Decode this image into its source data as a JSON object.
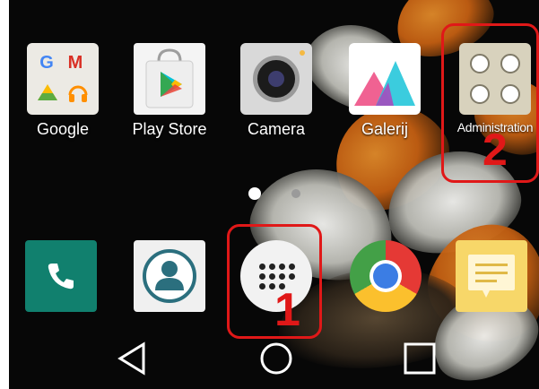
{
  "home_row": [
    {
      "label": "Google",
      "icon": "google-folder-icon"
    },
    {
      "label": "Play Store",
      "icon": "play-store-icon"
    },
    {
      "label": "Camera",
      "icon": "camera-icon"
    },
    {
      "label": "Galerij",
      "icon": "gallery-icon"
    },
    {
      "label": "Administration",
      "icon": "admin-folder-icon"
    }
  ],
  "google_folder_letters": [
    "G",
    "M"
  ],
  "page_indicator": {
    "pages": 2,
    "current": 1
  },
  "dock": [
    {
      "icon": "phone-icon"
    },
    {
      "icon": "contacts-icon"
    },
    {
      "icon": "apps-drawer-icon"
    },
    {
      "icon": "chrome-icon"
    },
    {
      "icon": "memo-icon"
    }
  ],
  "annotations": [
    {
      "label": "1",
      "target": "apps-drawer-button"
    },
    {
      "label": "2",
      "target": "administration-folder"
    }
  ],
  "navbar": {
    "back": "back-icon",
    "home": "home-icon",
    "recents": "recents-icon"
  },
  "colors": {
    "annotation": "#e01818",
    "phone": "#11806e",
    "memo": "#f7d769"
  }
}
